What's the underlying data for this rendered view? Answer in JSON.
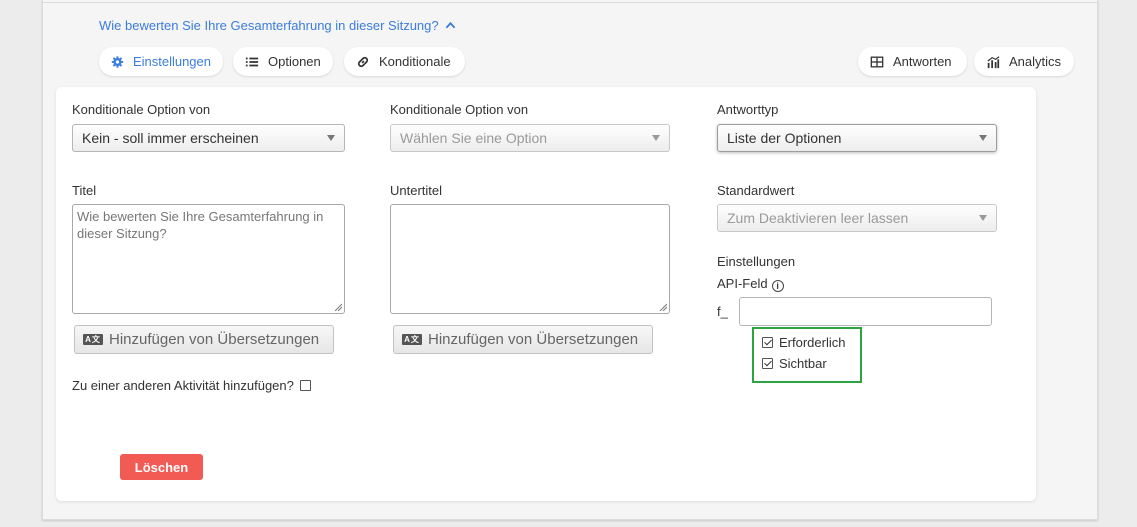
{
  "question": {
    "title": "Wie bewerten Sie Ihre Gesamterfahrung in dieser Sitzung?",
    "toggle_icon": "chevron-up-icon"
  },
  "tabs": {
    "settings": {
      "label": "Einstellungen",
      "icon": "gear-icon",
      "active": true
    },
    "options": {
      "label": "Optionen",
      "icon": "list-icon"
    },
    "conditionals": {
      "label": "Konditionale",
      "icon": "link-icon"
    },
    "answers": {
      "label": "Antworten",
      "icon": "table-icon"
    },
    "analytics": {
      "label": "Analytics",
      "icon": "chart-icon"
    }
  },
  "form": {
    "conditional1": {
      "label": "Konditionale Option von",
      "value": "Kein - soll immer erscheinen"
    },
    "conditional2": {
      "label": "Konditionale Option von",
      "placeholder": "Wählen Sie eine Option"
    },
    "answer_type": {
      "label": "Antworttyp",
      "value": "Liste der Optionen"
    },
    "title": {
      "label": "Titel",
      "value": "Wie bewerten Sie Ihre Gesamterfahrung in dieser Sitzung?"
    },
    "subtitle": {
      "label": "Untertitel",
      "value": ""
    },
    "default_value": {
      "label": "Standardwert",
      "placeholder": "Zum Deaktivieren leer lassen"
    },
    "translation_button": {
      "label": "Hinzufügen von Übersetzungen",
      "icon_text": "A文"
    },
    "settings_heading": "Einstellungen",
    "api_field": {
      "label": "API-Feld",
      "prefix": "f_",
      "value": ""
    },
    "required": {
      "label": "Erforderlich",
      "checked": true
    },
    "visible": {
      "label": "Sichtbar",
      "checked": true
    },
    "add_to_other": {
      "label": "Zu einer anderen Aktivität hinzufügen?",
      "checked": false
    },
    "delete_button": "Löschen"
  },
  "colors": {
    "accent": "#3b7ddd",
    "danger": "#f25a54",
    "highlight": "#2da440"
  }
}
